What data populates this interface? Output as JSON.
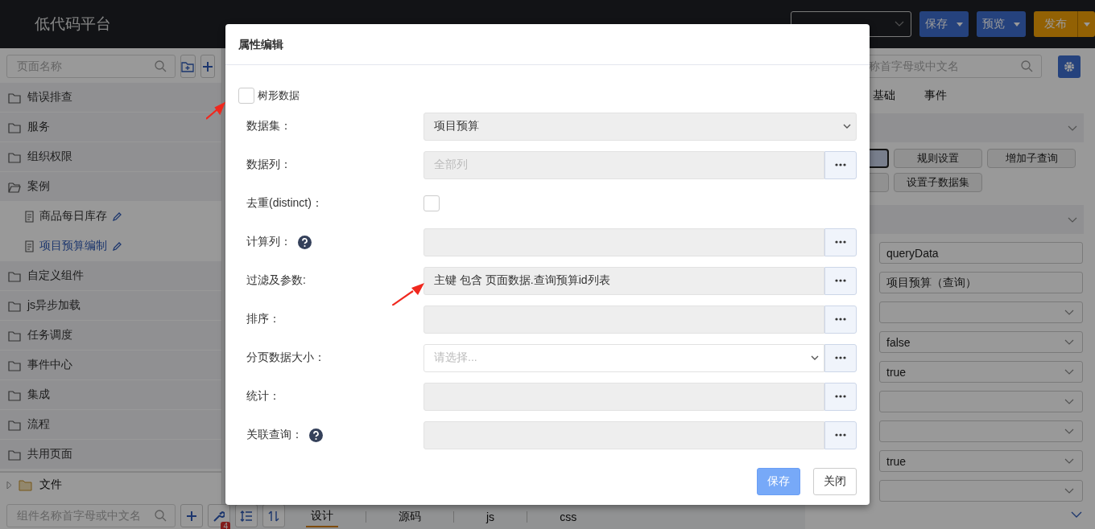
{
  "header": {
    "title": "低代码平台",
    "buttons": [
      {
        "label": "保存",
        "kind": "primary"
      },
      {
        "label": "预览",
        "kind": "primary"
      },
      {
        "label": "发布",
        "kind": "warning"
      }
    ]
  },
  "sidebar": {
    "search": {
      "placeholder": "页面名称"
    },
    "items": [
      {
        "label": "错误排查"
      },
      {
        "label": "服务"
      },
      {
        "label": "组织权限"
      },
      {
        "label": "案例",
        "expanded": true,
        "children": [
          {
            "label": "商品每日库存",
            "selected": false
          },
          {
            "label": "项目预算编制",
            "selected": true
          }
        ]
      },
      {
        "label": "自定义组件"
      },
      {
        "label": "js异步加载"
      },
      {
        "label": "任务调度"
      },
      {
        "label": "事件中心"
      },
      {
        "label": "集成"
      },
      {
        "label": "流程"
      },
      {
        "label": "共用页面"
      }
    ],
    "files": {
      "label": "文件",
      "expanded": false
    },
    "component_search": {
      "placeholder": "组件名称首字母或中文名"
    },
    "badge": "4"
  },
  "editor_tabs": [
    {
      "label": "设计",
      "selected": true
    },
    {
      "label": "源码",
      "selected": false
    },
    {
      "label": "js",
      "selected": false
    },
    {
      "label": "css",
      "selected": false
    }
  ],
  "right_panel": {
    "search": {
      "placeholder": "称首字母或中文名"
    },
    "tabs": [
      {
        "label": "基础"
      },
      {
        "label": "事件"
      }
    ],
    "buttons": [
      {
        "label": "规则设置"
      },
      {
        "label": "增加子查询"
      },
      {
        "label": "设置子数据集"
      }
    ],
    "fields": [
      {
        "kind": "input",
        "value": "queryData"
      },
      {
        "kind": "input",
        "value": "项目预算（查询）"
      },
      {
        "kind": "select"
      },
      {
        "kind": "select",
        "value": "false"
      },
      {
        "kind": "select",
        "value": "true"
      },
      {
        "kind": "select"
      },
      {
        "kind": "select"
      },
      {
        "kind": "select",
        "value": "true"
      },
      {
        "kind": "select"
      }
    ]
  },
  "dialog": {
    "title": "属性编辑",
    "tree_checkbox": {
      "label": "树形数据",
      "checked": false
    },
    "rows": [
      {
        "label": "数据集：",
        "kind": "select",
        "value": "项目预算"
      },
      {
        "label": "数据列：",
        "kind": "picker",
        "placeholder": "全部列"
      },
      {
        "label": "去重(distinct)：",
        "kind": "checkbox",
        "checked": false
      },
      {
        "label": "计算列：",
        "kind": "picker",
        "help": true
      },
      {
        "label": "过滤及参数:",
        "kind": "picker",
        "value": "主键 包含 页面数据.查询预算id列表"
      },
      {
        "label": "排序：",
        "kind": "picker"
      },
      {
        "label": "分页数据大小：",
        "kind": "select_picker",
        "placeholder": "请选择..."
      },
      {
        "label": "统计：",
        "kind": "picker"
      },
      {
        "label": "关联查询：",
        "kind": "picker",
        "help": true
      }
    ],
    "buttons": [
      {
        "label": "保存",
        "kind": "primary"
      },
      {
        "label": "关闭",
        "kind": "default"
      }
    ]
  }
}
